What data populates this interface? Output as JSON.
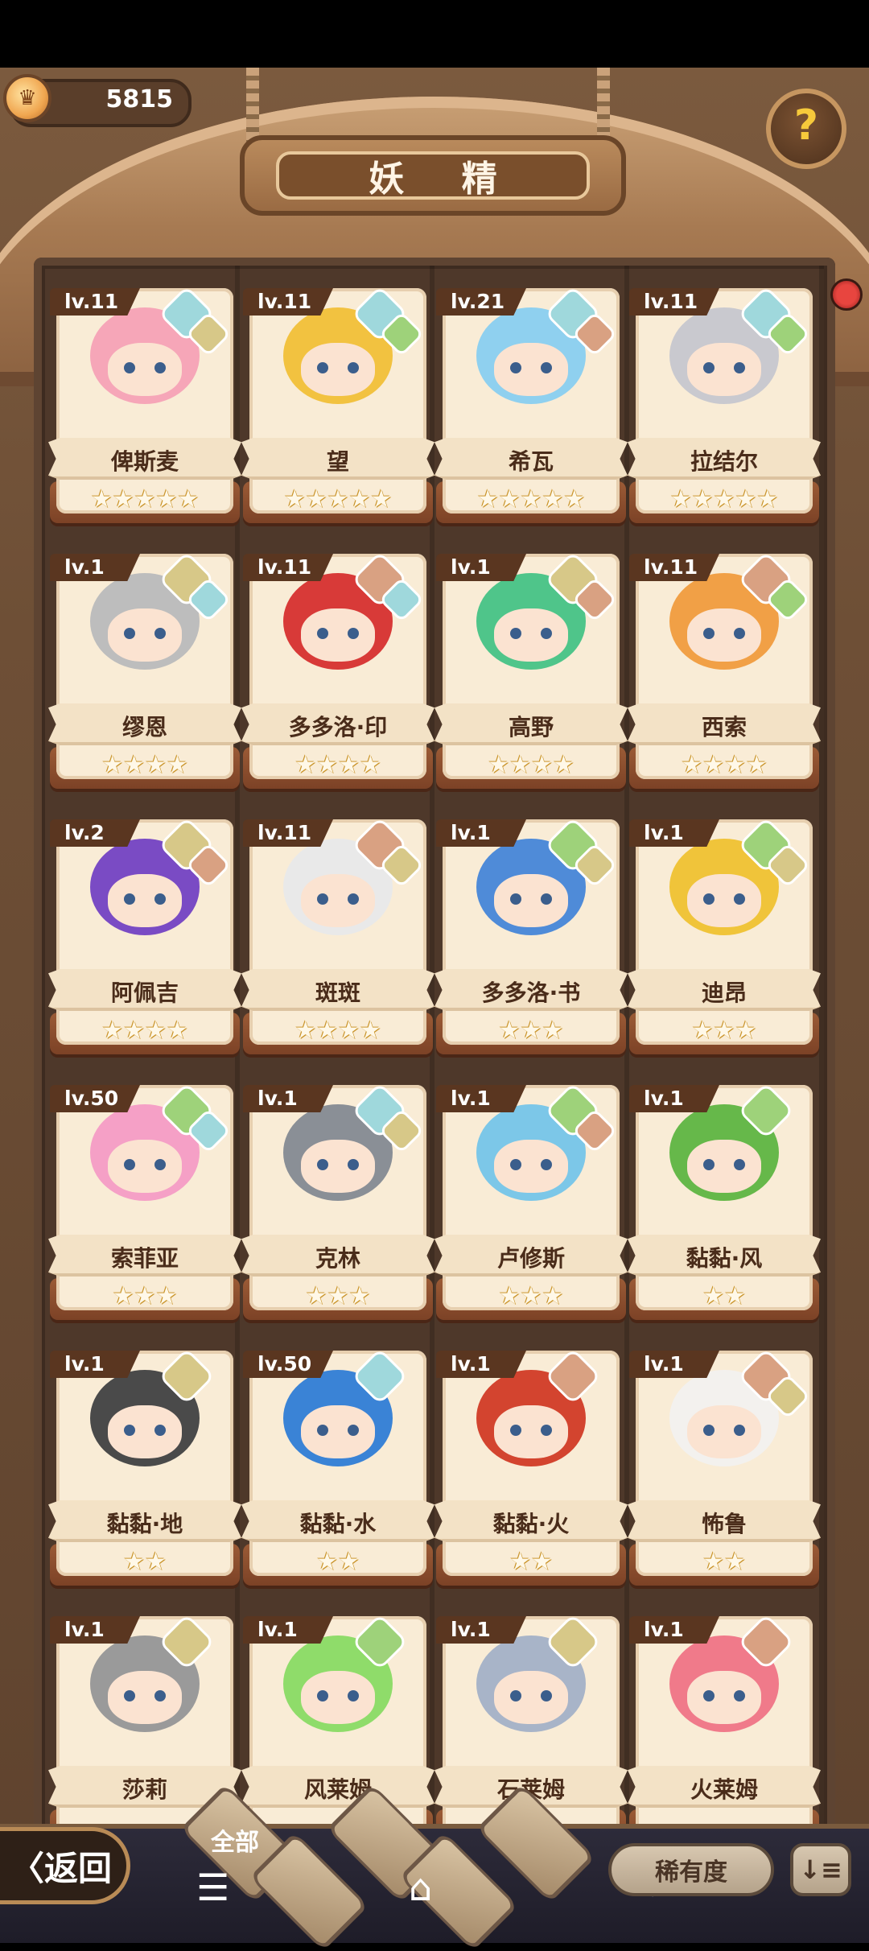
{
  "coins": {
    "value": "5815"
  },
  "title": "妖 精",
  "help_icon": "question-mark-sprout-icon",
  "fairies": [
    {
      "level": "lv.11",
      "name": "俾斯麦",
      "stars": 5,
      "hair": "#f6a6b8",
      "elem1": "#9fd8dc",
      "elem2": "#d7c888"
    },
    {
      "level": "lv.11",
      "name": "望",
      "stars": 5,
      "hair": "#f2c240",
      "elem1": "#9fd8dc",
      "elem2": "#9ed27a"
    },
    {
      "level": "lv.21",
      "name": "希瓦",
      "stars": 5,
      "hair": "#8fd0ef",
      "elem1": "#9fd8dc",
      "elem2": "#d9a182"
    },
    {
      "level": "lv.11",
      "name": "拉结尔",
      "stars": 5,
      "hair": "#c9c9cf",
      "elem1": "#9fd8dc",
      "elem2": "#9ed27a"
    },
    {
      "level": "lv.1",
      "name": "缪恩",
      "stars": 4,
      "hair": "#bdbdbd",
      "elem1": "#d7c888",
      "elem2": "#9fd8dc"
    },
    {
      "level": "lv.11",
      "name": "多多洛·印",
      "stars": 4,
      "hair": "#d83a38",
      "elem1": "#d9a182",
      "elem2": "#9fd8dc"
    },
    {
      "level": "lv.1",
      "name": "高野",
      "stars": 4,
      "hair": "#4fc58a",
      "elem1": "#d7c888",
      "elem2": "#d9a182"
    },
    {
      "level": "lv.11",
      "name": "西索",
      "stars": 4,
      "hair": "#f1a046",
      "elem1": "#d9a182",
      "elem2": "#9ed27a"
    },
    {
      "level": "lv.2",
      "name": "阿佩吉",
      "stars": 4,
      "hair": "#7a4bc4",
      "elem1": "#d7c888",
      "elem2": "#d9a182"
    },
    {
      "level": "lv.11",
      "name": "斑斑",
      "stars": 4,
      "hair": "#e9e9e9",
      "elem1": "#d9a182",
      "elem2": "#d7c888"
    },
    {
      "level": "lv.1",
      "name": "多多洛·书",
      "stars": 3,
      "hair": "#4f8bd8",
      "elem1": "#9ed27a",
      "elem2": "#d7c888"
    },
    {
      "level": "lv.1",
      "name": "迪昂",
      "stars": 3,
      "hair": "#f0c43a",
      "elem1": "#9ed27a",
      "elem2": "#d7c888"
    },
    {
      "level": "lv.50",
      "name": "索菲亚",
      "stars": 3,
      "hair": "#f5a0c6",
      "elem1": "#9ed27a",
      "elem2": "#9fd8dc"
    },
    {
      "level": "lv.1",
      "name": "克林",
      "stars": 3,
      "hair": "#8a8f96",
      "elem1": "#9fd8dc",
      "elem2": "#d7c888"
    },
    {
      "level": "lv.1",
      "name": "卢修斯",
      "stars": 3,
      "hair": "#7cc7e8",
      "elem1": "#9ed27a",
      "elem2": "#d9a182"
    },
    {
      "level": "lv.1",
      "name": "黏黏·风",
      "stars": 2,
      "hair": "#66b84a",
      "elem1": "#9ed27a",
      "elem2": ""
    },
    {
      "level": "lv.1",
      "name": "黏黏·地",
      "stars": 2,
      "hair": "#4a4a4a",
      "elem1": "#d7c888",
      "elem2": ""
    },
    {
      "level": "lv.50",
      "name": "黏黏·水",
      "stars": 2,
      "hair": "#3a83d6",
      "elem1": "#9fd8dc",
      "elem2": ""
    },
    {
      "level": "lv.1",
      "name": "黏黏·火",
      "stars": 2,
      "hair": "#d3442f",
      "elem1": "#d9a182",
      "elem2": ""
    },
    {
      "level": "lv.1",
      "name": "怖鲁",
      "stars": 2,
      "hair": "#f3f1ee",
      "elem1": "#d9a182",
      "elem2": "#d7c888"
    },
    {
      "level": "lv.1",
      "name": "莎莉",
      "stars": 0,
      "hair": "#9a9a9a",
      "elem1": "#d7c888",
      "elem2": ""
    },
    {
      "level": "lv.1",
      "name": "风莱姆",
      "stars": 0,
      "hair": "#8fdc6a",
      "elem1": "#9ed27a",
      "elem2": ""
    },
    {
      "level": "lv.1",
      "name": "石莱姆",
      "stars": 0,
      "hair": "#a8b4c8",
      "elem1": "#d7c888",
      "elem2": ""
    },
    {
      "level": "lv.1",
      "name": "火莱姆",
      "stars": 0,
      "hair": "#f07a8a",
      "elem1": "#d9a182",
      "elem2": ""
    }
  ],
  "bottom": {
    "back_label": "〈返回",
    "filter_all": "全部",
    "rarity_label": "稀有度",
    "sort_icon": "sort-list-icon",
    "menu_icon": "menu-icon",
    "home_icon": "home-icon",
    "back_nav_icon": "back-arrow-icon"
  }
}
